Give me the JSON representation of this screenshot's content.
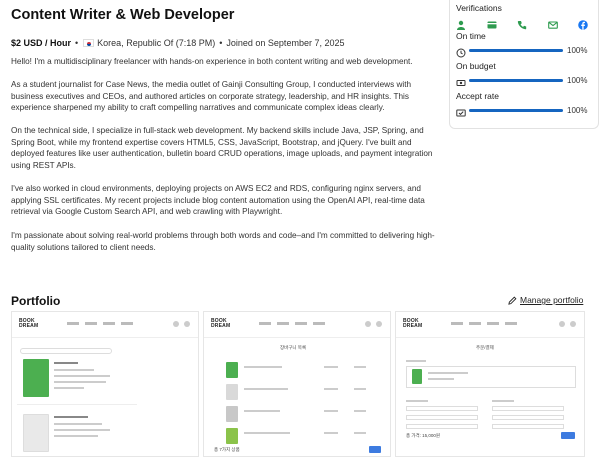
{
  "profile": {
    "title": "Content Writer & Web Developer",
    "rate": "$2 USD / Hour",
    "location_sep": "•",
    "location": "Korea, Republic Of (7:18 PM)",
    "joined_sep": "•",
    "joined": "Joined on September 7, 2025"
  },
  "bio": [
    "Hello! I'm a multidisciplinary freelancer with hands-on experience in both content writing and web development.",
    "As a student journalist for Case News, the media outlet of Gainji Consulting Group, I conducted interviews with business executives and CEOs, and authored articles on corporate strategy, leadership, and HR insights. This experience sharpened my ability to craft compelling narratives and communicate complex ideas clearly.",
    "On the technical side, I specialize in full-stack web development. My backend skills include Java, JSP, Spring, and Spring Boot, while my frontend expertise covers HTML5, CSS, JavaScript, Bootstrap, and jQuery. I've built and deployed features like user authentication, bulletin board CRUD operations, image uploads, and payment integration using REST APIs.",
    "I've also worked in cloud environments, deploying projects on AWS EC2 and RDS, configuring nginx servers, and applying SSL certificates. My recent projects include blog content automation using the OpenAI API, real-time data retrieval via Google Custom Search API, and web crawling with Playwright.",
    "I'm passionate about solving real-world problems through both words and code–and I'm committed to delivering high-quality solutions tailored to client needs."
  ],
  "verifications": {
    "title": "Verifications",
    "icons": [
      "person-icon",
      "payment-icon",
      "phone-icon",
      "email-icon",
      "facebook-icon"
    ],
    "metrics": [
      {
        "label": "On time",
        "icon": "clock-icon",
        "value": 1.0,
        "pct": "100%"
      },
      {
        "label": "On budget",
        "icon": "budget-icon",
        "value": 1.0,
        "pct": "100%"
      },
      {
        "label": "Accept rate",
        "icon": "accept-icon",
        "value": 1.0,
        "pct": "100%"
      }
    ]
  },
  "portfolio": {
    "title": "Portfolio",
    "manage": "Manage portfolio",
    "thumbnails": [
      {
        "logo": "BOOK DREAM"
      },
      {
        "logo": "BOOK DREAM",
        "heading": "장바구니 목록",
        "total": "총 7가지 상품"
      },
      {
        "logo": "BOOK DREAM",
        "heading": "주문/결제",
        "total": "총 가격: 15,000원"
      }
    ]
  },
  "colors": {
    "accent": "#1565c0",
    "icon_green": "#2e9b4f",
    "facebook": "#1877f2",
    "book_green": "#4caf50"
  }
}
